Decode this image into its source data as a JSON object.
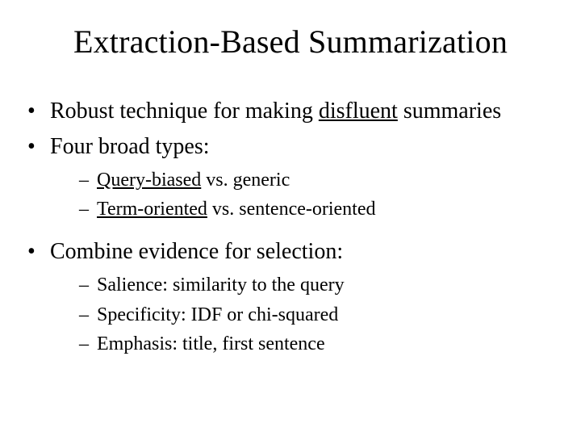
{
  "title": "Extraction-Based Summarization",
  "bullets": {
    "b1_pre": "Robust technique for making ",
    "b1_u": "disfluent",
    "b1_post": " summaries",
    "b2": "Four broad types:",
    "b2_sub": {
      "s1_u": "Query-biased",
      "s1_post": " vs. generic",
      "s2_u": "Term-oriented",
      "s2_post": " vs. sentence-oriented"
    },
    "b3": "Combine evidence for selection:",
    "b3_sub": {
      "s1": "Salience: similarity to the query",
      "s2": "Specificity: IDF or chi-squared",
      "s3": "Emphasis: title, first sentence"
    }
  }
}
